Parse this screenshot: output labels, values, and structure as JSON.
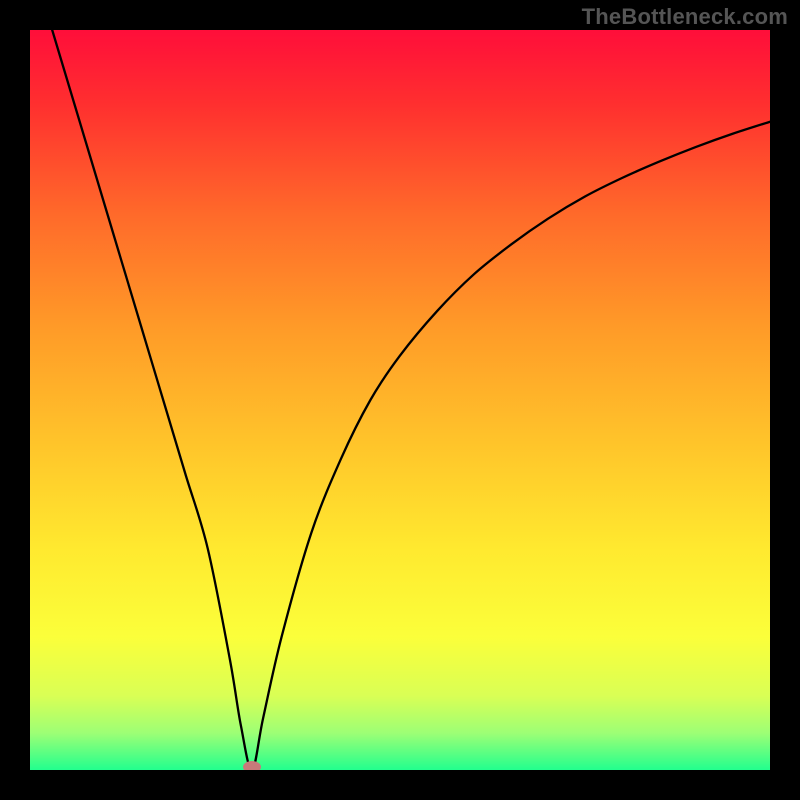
{
  "watermark": "TheBottleneck.com",
  "chart_data": {
    "type": "line",
    "title": "",
    "xlabel": "",
    "ylabel": "",
    "xlim": [
      0,
      100
    ],
    "ylim": [
      0,
      100
    ],
    "grid": false,
    "curve_color": "#000000",
    "marker": {
      "x": 30,
      "y": 0,
      "color": "#c77a7a"
    },
    "background_gradient_stops": [
      {
        "offset": 0.0,
        "color": "#ff0e3a"
      },
      {
        "offset": 0.1,
        "color": "#ff2f2f"
      },
      {
        "offset": 0.25,
        "color": "#ff6a2a"
      },
      {
        "offset": 0.4,
        "color": "#ff9a28"
      },
      {
        "offset": 0.55,
        "color": "#ffc22a"
      },
      {
        "offset": 0.7,
        "color": "#ffe92f"
      },
      {
        "offset": 0.82,
        "color": "#fbff3a"
      },
      {
        "offset": 0.9,
        "color": "#d9ff55"
      },
      {
        "offset": 0.95,
        "color": "#9dff75"
      },
      {
        "offset": 1.0,
        "color": "#22ff8e"
      }
    ],
    "series": [
      {
        "name": "curve",
        "x": [
          0,
          3,
          6,
          9,
          12,
          15,
          18,
          21,
          24,
          27,
          28.5,
          30,
          31.5,
          34,
          38,
          42,
          46,
          50,
          55,
          60,
          65,
          70,
          75,
          80,
          85,
          90,
          95,
          100
        ],
        "y": [
          110,
          100,
          90,
          80,
          70,
          60,
          50,
          40,
          30,
          15,
          6,
          0,
          7,
          18,
          32,
          42,
          50,
          56,
          62,
          67,
          71,
          74.5,
          77.5,
          80,
          82.2,
          84.2,
          86,
          87.6
        ]
      }
    ]
  }
}
